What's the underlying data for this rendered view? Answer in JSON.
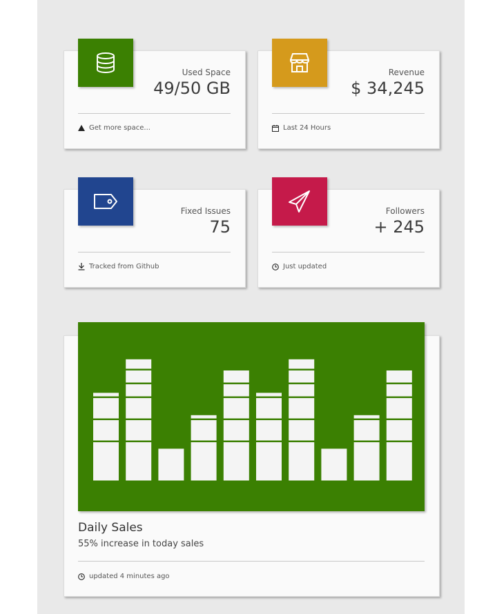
{
  "cards": [
    {
      "label": "Used Space",
      "value": "49/50 GB",
      "footer": "Get more space...",
      "icon": "database-icon",
      "footer_icon": "warning-icon",
      "color": "#3b8002"
    },
    {
      "label": "Revenue",
      "value": "$ 34,245",
      "footer": "Last 24 Hours",
      "icon": "store-icon",
      "footer_icon": "calendar-icon",
      "color": "#d59a1c"
    },
    {
      "label": "Fixed Issues",
      "value": "75",
      "footer": "Tracked from Github",
      "icon": "tag-icon",
      "footer_icon": "download-icon",
      "color": "#21458f"
    },
    {
      "label": "Followers",
      "value": "+ 245",
      "footer": "Just updated",
      "icon": "paper-plane-icon",
      "footer_icon": "clock-icon",
      "color": "#c51a4a"
    }
  ],
  "sales": {
    "title": "Daily Sales",
    "subtitle": "55% increase in today sales",
    "footer": "updated 4 minutes ago",
    "footer_icon": "clock-icon",
    "chart_bg": "#3b8002",
    "bar_color": "#f4f4f4"
  },
  "chart_data": {
    "type": "bar",
    "bars_are_segmented": true,
    "values": [
      8,
      11,
      3,
      6,
      10,
      8,
      11,
      3,
      6,
      10
    ]
  }
}
